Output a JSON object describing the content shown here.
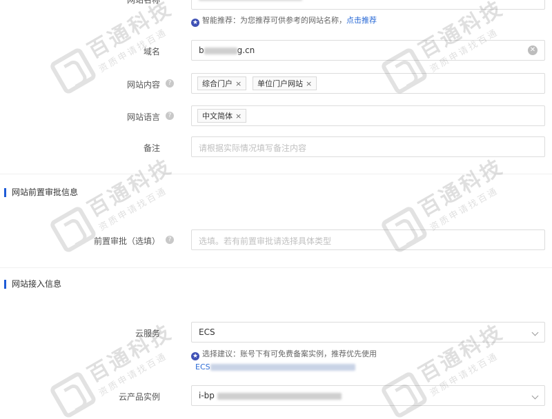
{
  "website_name": {
    "label": "网站名称",
    "hint_prefix": "智能推荐：为您推荐可供参考的网站名称，",
    "hint_link": "点击推荐"
  },
  "domain": {
    "label": "域名",
    "value": "b",
    "value_suffix": "g.cn"
  },
  "content": {
    "label": "网站内容",
    "tags": [
      "综合门户",
      "单位门户网站"
    ]
  },
  "language": {
    "label": "网站语言",
    "tags": [
      "中文简体"
    ]
  },
  "remark": {
    "label": "备注",
    "placeholder": "请根据实际情况填写备注内容"
  },
  "section_pre_approval": {
    "title": "网站前置审批信息"
  },
  "pre_approval": {
    "label": "前置审批（选填）",
    "placeholder": "选填。若有前置审批请选择具体类型"
  },
  "section_access": {
    "title": "网站接入信息"
  },
  "cloud_service": {
    "label": "云服务",
    "value": "ECS",
    "hint": "选择建议：账号下有可免费备案实例，推荐优先使用",
    "link_prefix": "ECS"
  },
  "cloud_instance": {
    "label": "云产品实例",
    "value_prefix": "i-bp"
  },
  "watermark": {
    "name": "百通科技",
    "slogan": "资质申请找百通"
  }
}
